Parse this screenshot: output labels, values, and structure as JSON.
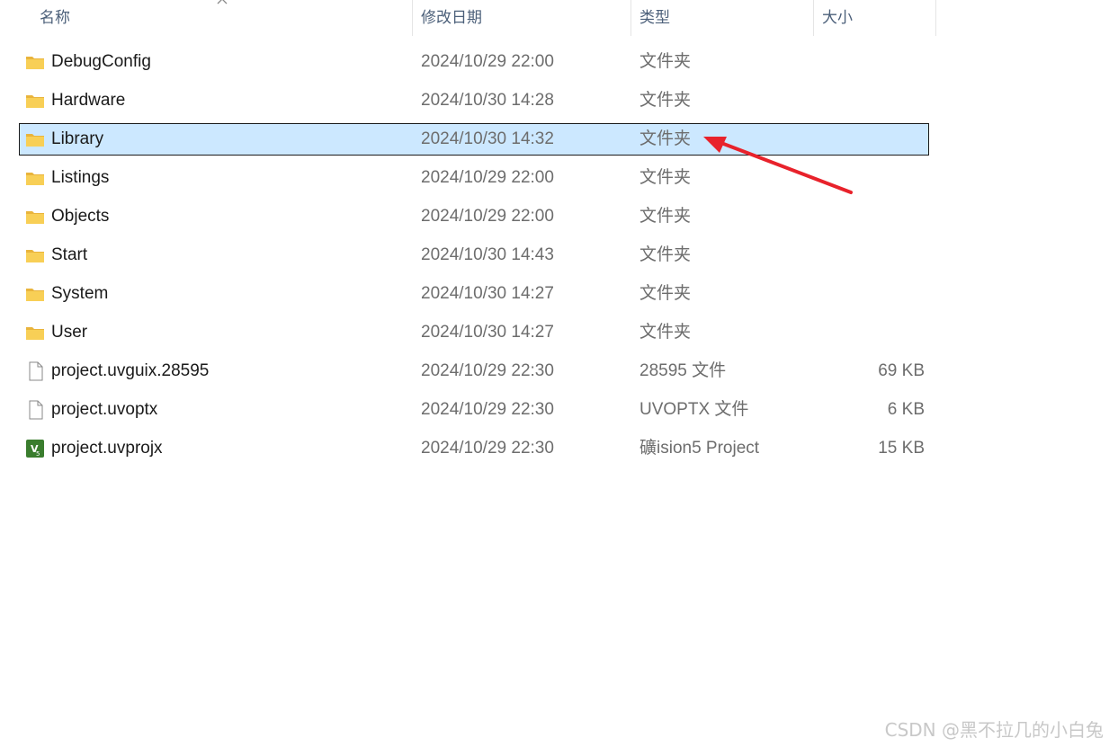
{
  "columns": {
    "name": "名称",
    "date": "修改日期",
    "type": "类型",
    "size": "大小"
  },
  "files": [
    {
      "name": "DebugConfig",
      "date": "2024/10/29 22:00",
      "type": "文件夹",
      "size": "",
      "icon": "folder-icon",
      "selected": false
    },
    {
      "name": "Hardware",
      "date": "2024/10/30 14:28",
      "type": "文件夹",
      "size": "",
      "icon": "folder-icon",
      "selected": false
    },
    {
      "name": "Library",
      "date": "2024/10/30 14:32",
      "type": "文件夹",
      "size": "",
      "icon": "folder-icon",
      "selected": true
    },
    {
      "name": "Listings",
      "date": "2024/10/29 22:00",
      "type": "文件夹",
      "size": "",
      "icon": "folder-icon",
      "selected": false
    },
    {
      "name": "Objects",
      "date": "2024/10/29 22:00",
      "type": "文件夹",
      "size": "",
      "icon": "folder-icon",
      "selected": false
    },
    {
      "name": "Start",
      "date": "2024/10/30 14:43",
      "type": "文件夹",
      "size": "",
      "icon": "folder-icon",
      "selected": false
    },
    {
      "name": "System",
      "date": "2024/10/30 14:27",
      "type": "文件夹",
      "size": "",
      "icon": "folder-icon",
      "selected": false
    },
    {
      "name": "User",
      "date": "2024/10/30 14:27",
      "type": "文件夹",
      "size": "",
      "icon": "folder-icon",
      "selected": false
    },
    {
      "name": "project.uvguix.28595",
      "date": "2024/10/29 22:30",
      "type": "28595 文件",
      "size": "69 KB",
      "icon": "file-icon",
      "selected": false
    },
    {
      "name": "project.uvoptx",
      "date": "2024/10/29 22:30",
      "type": "UVOPTX 文件",
      "size": "6 KB",
      "icon": "file-icon",
      "selected": false
    },
    {
      "name": "project.uvprojx",
      "date": "2024/10/29 22:30",
      "type": "礦ision5 Project",
      "size": "15 KB",
      "icon": "uvision-project-icon",
      "selected": false
    }
  ],
  "colors": {
    "selection_bg": "#cce8ff",
    "folder": "#f8c94a",
    "arrow": "#e8222b",
    "uvision": "#3a7d2e"
  },
  "watermark": "CSDN @黑不拉几的小白兔"
}
